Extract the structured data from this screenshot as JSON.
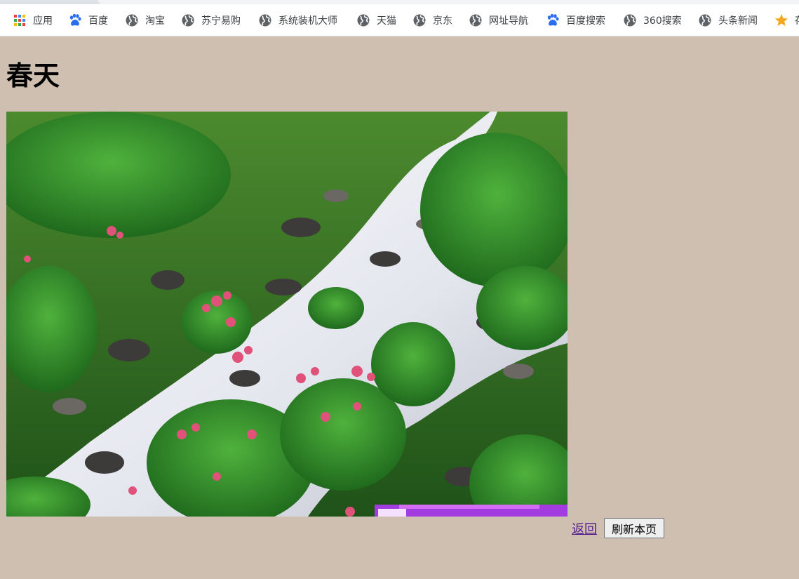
{
  "bookmarks": [
    {
      "label": "应用",
      "icon": "apps-grid-icon"
    },
    {
      "label": "百度",
      "icon": "baidu-paw-icon"
    },
    {
      "label": "淘宝",
      "icon": "globe-icon"
    },
    {
      "label": "苏宁易购",
      "icon": "globe-icon"
    },
    {
      "label": "系统装机大师",
      "icon": "globe-icon"
    },
    {
      "label": "天猫",
      "icon": "globe-icon"
    },
    {
      "label": "京东",
      "icon": "globe-icon"
    },
    {
      "label": "网址导航",
      "icon": "globe-icon"
    },
    {
      "label": "百度搜索",
      "icon": "baidu-paw-icon"
    },
    {
      "label": "360搜索",
      "icon": "globe-icon"
    },
    {
      "label": "头条新闻",
      "icon": "globe-icon"
    },
    {
      "label": "存",
      "icon": "star-icon"
    }
  ],
  "page": {
    "title": "春天",
    "back_label": "返回",
    "refresh_label": "刷新本页"
  },
  "colors": {
    "page_background": "#cfbfb1",
    "link_visited": "#551a8b",
    "baidu_blue": "#2a6ef0",
    "star_orange": "#f5a623",
    "globe_gray": "#5f6368"
  }
}
